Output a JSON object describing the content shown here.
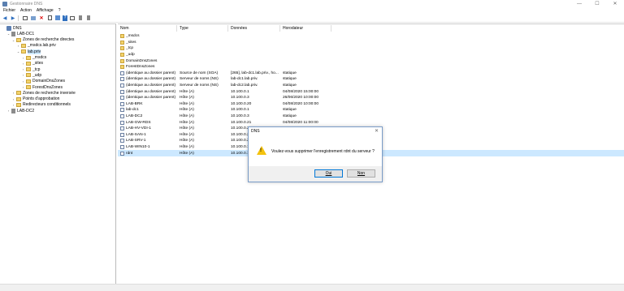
{
  "window": {
    "title": "Gestionnaire DNS",
    "controls": [
      "—",
      "☐",
      "✕"
    ]
  },
  "menu": [
    "Fichier",
    "Action",
    "Affichage",
    "?"
  ],
  "toolbar": [
    "◀",
    "▶",
    "",
    "",
    "✕",
    "",
    "",
    "?",
    "",
    "",
    ""
  ],
  "tree": [
    {
      "label": "DNS",
      "icon": "dns-icon",
      "level": 0,
      "exp": ""
    },
    {
      "label": "LAB-DC1",
      "icon": "server-icon",
      "level": 1,
      "exp": "⌄"
    },
    {
      "label": "Zones de recherche directes",
      "icon": "folder-icon",
      "level": 2,
      "exp": "⌄"
    },
    {
      "label": "_msdcs.lab.priv",
      "icon": "folder-icon",
      "level": 3,
      "exp": "›"
    },
    {
      "label": "lab.priv",
      "icon": "folder-icon",
      "level": 3,
      "exp": "⌄",
      "selected": true
    },
    {
      "label": "_msdcs",
      "icon": "folder-icon",
      "level": 4,
      "exp": "›"
    },
    {
      "label": "_sites",
      "icon": "folder-icon",
      "level": 4,
      "exp": "›"
    },
    {
      "label": "_tcp",
      "icon": "folder-icon",
      "level": 4,
      "exp": "›"
    },
    {
      "label": "_udp",
      "icon": "folder-icon",
      "level": 4,
      "exp": "›"
    },
    {
      "label": "DomainDnsZones",
      "icon": "folder-icon",
      "level": 4,
      "exp": "›"
    },
    {
      "label": "ForestDnsZones",
      "icon": "folder-icon",
      "level": 4,
      "exp": "›"
    },
    {
      "label": "Zones de recherche inversée",
      "icon": "folder-icon",
      "level": 2,
      "exp": "›"
    },
    {
      "label": "Points d'approbation",
      "icon": "folder-icon",
      "level": 2,
      "exp": "›"
    },
    {
      "label": "Redirecteurs conditionnels",
      "icon": "folder-icon",
      "level": 2,
      "exp": "›"
    },
    {
      "label": "LAB-DC2",
      "icon": "server-icon",
      "level": 1,
      "exp": "›"
    }
  ],
  "columns": [
    "Nom",
    "Type",
    "Données",
    "Horodateur"
  ],
  "rows": [
    {
      "icon": "folder",
      "name": "_msdcs",
      "type": "",
      "data": "",
      "time": ""
    },
    {
      "icon": "folder",
      "name": "_sites",
      "type": "",
      "data": "",
      "time": ""
    },
    {
      "icon": "folder",
      "name": "_tcp",
      "type": "",
      "data": "",
      "time": ""
    },
    {
      "icon": "folder",
      "name": "_udp",
      "type": "",
      "data": "",
      "time": ""
    },
    {
      "icon": "folder",
      "name": "DomainDnsZones",
      "type": "",
      "data": "",
      "time": ""
    },
    {
      "icon": "folder",
      "name": "ForestDnsZones",
      "type": "",
      "data": "",
      "time": ""
    },
    {
      "icon": "record",
      "name": "(identique au dossier parent)",
      "type": "Source de nom (SOA)",
      "data": "[265], lab-dc1.lab.priv., ho...",
      "time": "statique"
    },
    {
      "icon": "record",
      "name": "(identique au dossier parent)",
      "type": "Serveur de noms (NS)",
      "data": "lab-dc1.lab.priv.",
      "time": "statique"
    },
    {
      "icon": "record",
      "name": "(identique au dossier parent)",
      "type": "Serveur de noms (NS)",
      "data": "lab-dc2.lab.priv.",
      "time": "statique"
    },
    {
      "icon": "record",
      "name": "(identique au dossier parent)",
      "type": "Hôte (A)",
      "data": "10.100.0.1",
      "time": "04/08/2020 15:00:00"
    },
    {
      "icon": "record",
      "name": "(identique au dossier parent)",
      "type": "Hôte (A)",
      "data": "10.100.0.3",
      "time": "26/06/2020 10:00:00"
    },
    {
      "icon": "record",
      "name": "LAB-BRK",
      "type": "Hôte (A)",
      "data": "10.100.0.20",
      "time": "04/08/2020 10:00:00"
    },
    {
      "icon": "record",
      "name": "lab-dc1",
      "type": "Hôte (A)",
      "data": "10.100.0.1",
      "time": "statique"
    },
    {
      "icon": "record",
      "name": "LAB-DC2",
      "type": "Hôte (A)",
      "data": "10.100.0.3",
      "time": "statique"
    },
    {
      "icon": "record",
      "name": "LAB-GW-RDS",
      "type": "Hôte (A)",
      "data": "10.100.0.21",
      "time": "04/08/2020 11:00:00"
    },
    {
      "icon": "record",
      "name": "LAB-HV-VDI-1",
      "type": "Hôte (A)",
      "data": "10.100.0.22",
      "time": ""
    },
    {
      "icon": "record",
      "name": "LAB-SAN-1",
      "type": "Hôte (A)",
      "data": "10.100.0.2",
      "time": ""
    },
    {
      "icon": "record",
      "name": "LAB-SRV-1",
      "type": "Hôte (A)",
      "data": "10.100.0.21",
      "time": ""
    },
    {
      "icon": "record",
      "name": "LAB-WIN10-1",
      "type": "Hôte (A)",
      "data": "10.100.0.12",
      "time": ""
    },
    {
      "icon": "record",
      "name": "rdnt",
      "type": "Hôte (A)",
      "data": "10.100.0.1",
      "time": "",
      "selected": true
    }
  ],
  "dialog": {
    "title": "DNS",
    "close": "✕",
    "warning_mark": "!",
    "message": "Voulez-vous supprimer l'enregistrement rdnt du serveur ?",
    "yes_label": "Oui",
    "no_label": "Non"
  },
  "colors": {
    "selection": "#cce8ff",
    "folder": "#f3d36b",
    "accent": "#0078d7"
  }
}
